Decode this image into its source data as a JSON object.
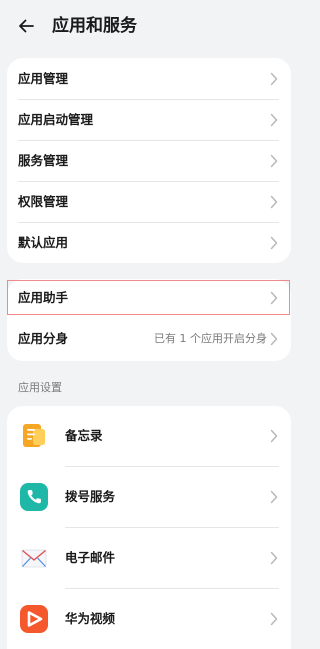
{
  "header": {
    "title": "应用和服务",
    "back_icon": "arrow-left-icon"
  },
  "group1": {
    "items": [
      {
        "label": "应用管理"
      },
      {
        "label": "应用启动管理"
      },
      {
        "label": "服务管理"
      },
      {
        "label": "权限管理"
      },
      {
        "label": "默认应用"
      }
    ]
  },
  "group2": {
    "items": [
      {
        "label": "应用助手",
        "highlight_color": "#f08a8a"
      },
      {
        "label": "应用分身",
        "value": "已有 1 个应用开启分身"
      }
    ]
  },
  "app_settings": {
    "section_label": "应用设置",
    "apps": [
      {
        "label": "备忘录",
        "icon": "memo-icon",
        "color": "#f5a623"
      },
      {
        "label": "拨号服务",
        "icon": "phone-icon",
        "color": "#1fb8a8"
      },
      {
        "label": "电子邮件",
        "icon": "mail-icon",
        "color": "#4a90e2"
      },
      {
        "label": "华为视频",
        "icon": "video-play-icon",
        "color": "#f5582c"
      }
    ]
  }
}
